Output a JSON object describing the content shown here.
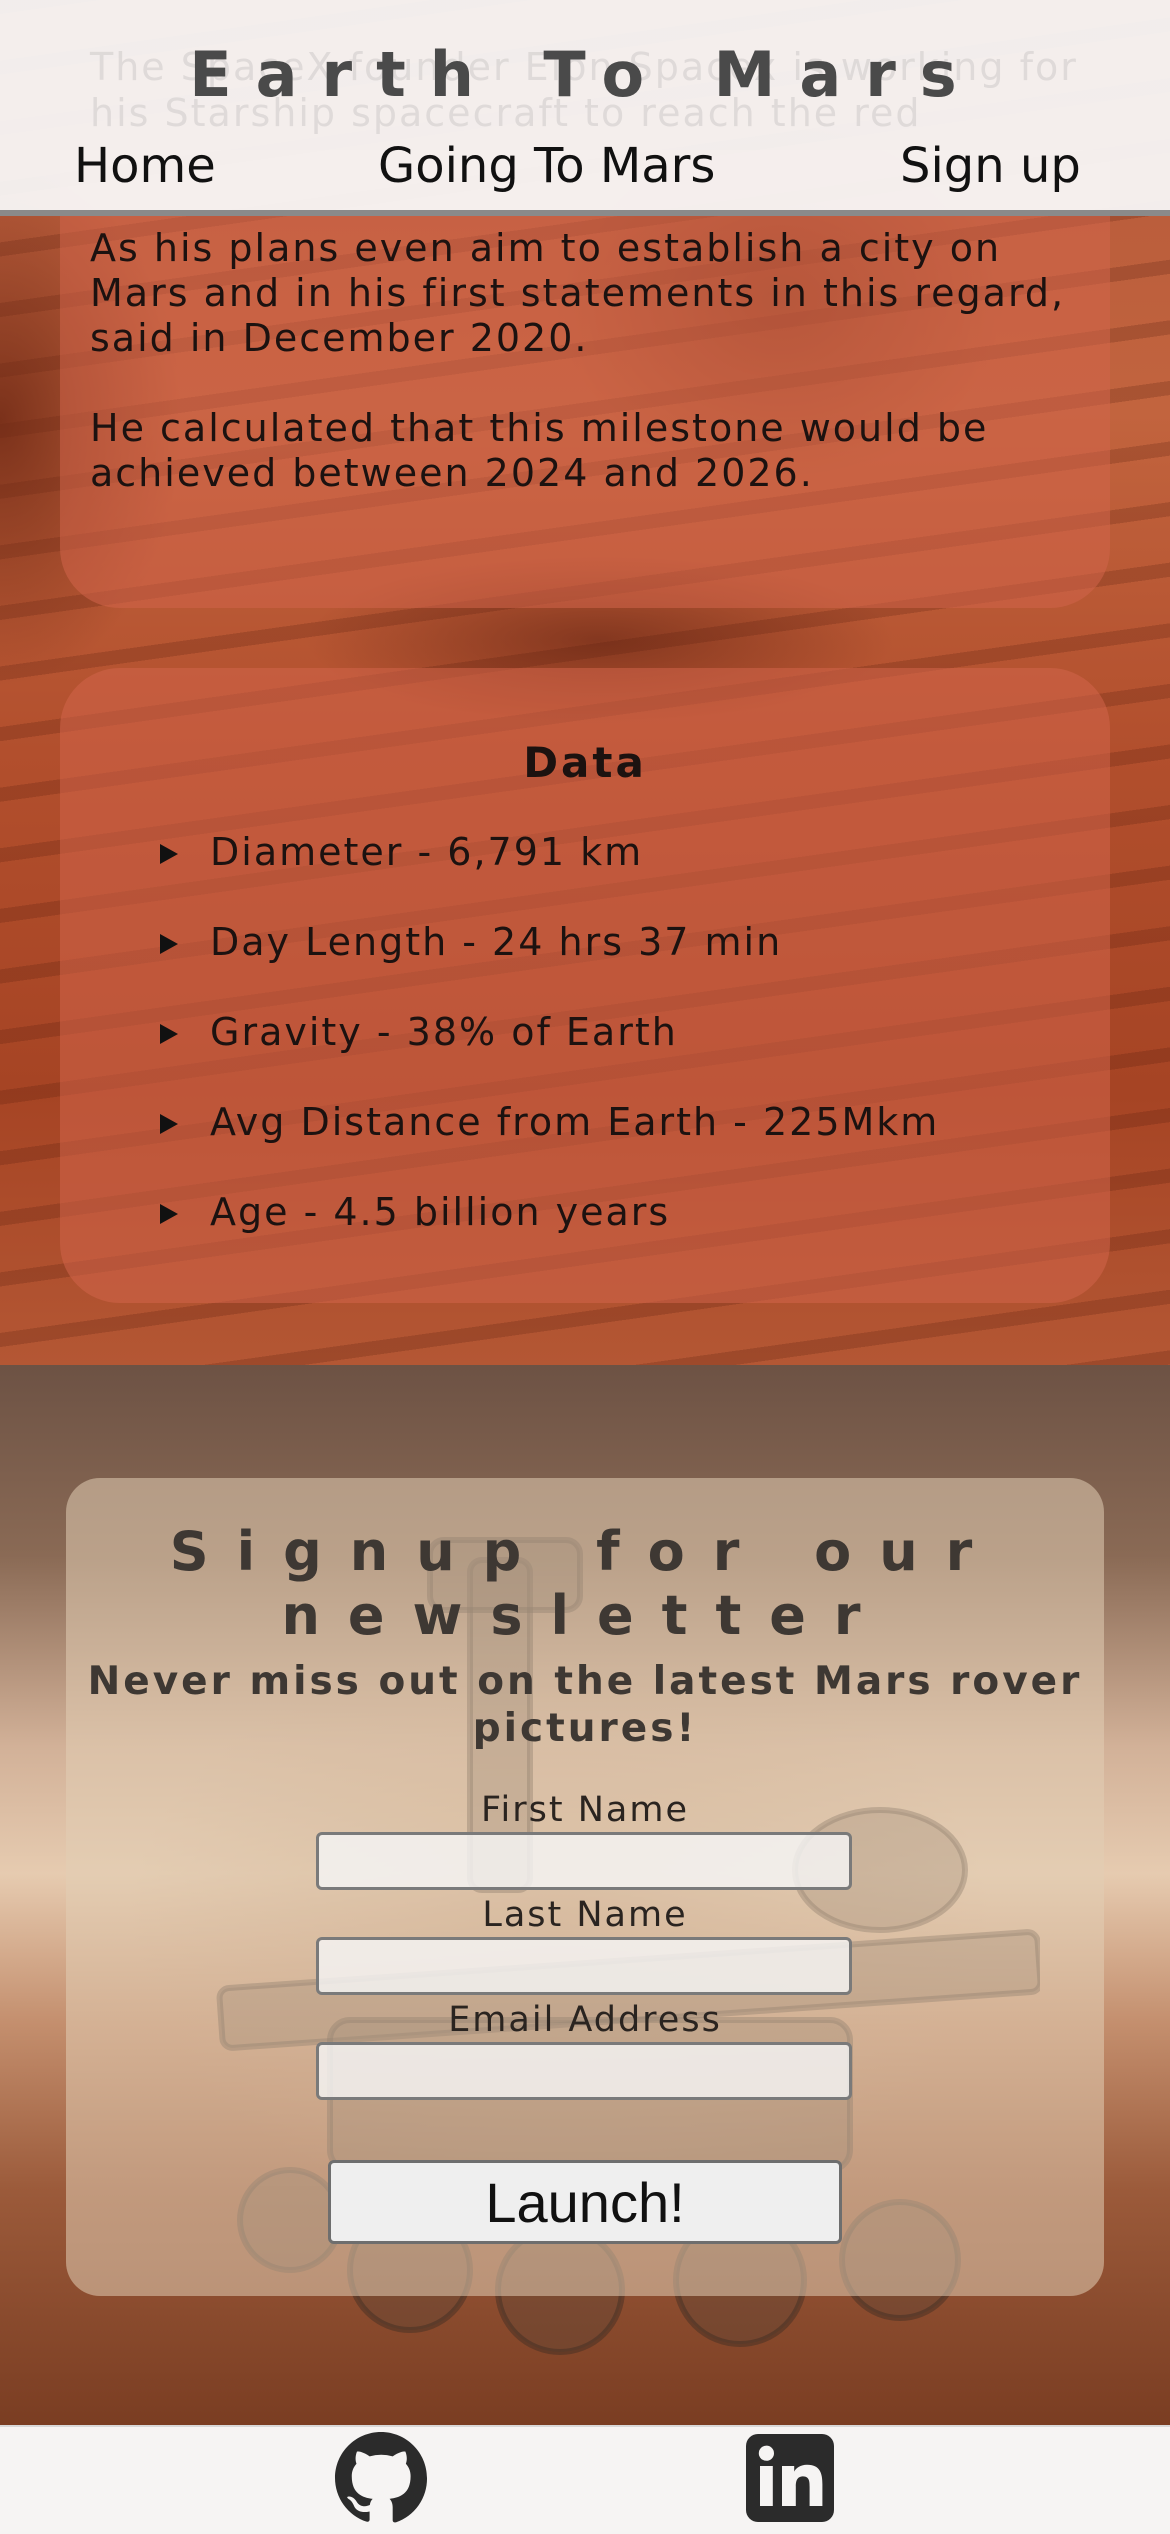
{
  "header": {
    "title": "Earth To Mars",
    "ghost_text": "The SpaceX founder Elon Spacex is working for his Starship spacecraft to reach the red",
    "nav": [
      {
        "label": "Home"
      },
      {
        "label": "Going To Mars"
      },
      {
        "label": "Sign up"
      }
    ]
  },
  "intro": {
    "text": "As his plans even aim to establish a city on Mars and in his first statements in this regard,\nsaid in December 2020.\n\nHe calculated that this milestone would be achieved between 2024 and 2026."
  },
  "data_section": {
    "title": "Data",
    "items": [
      {
        "text": "Diameter - 6,791 km"
      },
      {
        "text": "Day Length - 24 hrs 37 min"
      },
      {
        "text": "Gravity - 38% of Earth"
      },
      {
        "text": "Avg Distance from Earth - 225Mkm"
      },
      {
        "text": "Age - 4.5 billion years"
      }
    ]
  },
  "newsletter": {
    "title": "Signup for our newsletter",
    "subtitle": "Never miss out on the latest Mars rover pictures!",
    "fields": [
      {
        "label": "First Name",
        "value": ""
      },
      {
        "label": "Last Name",
        "value": ""
      },
      {
        "label": "Email Address",
        "value": ""
      }
    ],
    "submit_label": "Launch!"
  },
  "footer": {
    "icons": [
      "github-icon",
      "linkedin-icon"
    ]
  },
  "colors": {
    "header_bg": "#f8f8f8",
    "card_overlay": "#d2644b",
    "title_gray": "#4a4a4a",
    "button_bg": "#efefef"
  }
}
